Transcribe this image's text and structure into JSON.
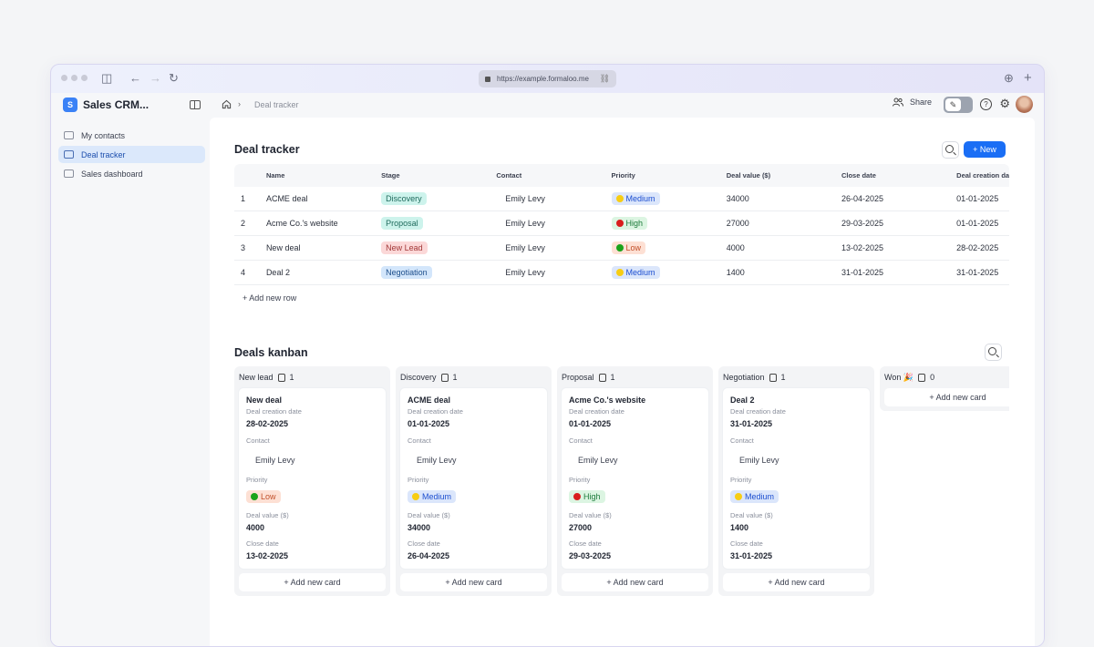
{
  "browser": {
    "url": "https://example.formaloo.me"
  },
  "app": {
    "logo_letter": "S",
    "name": "Sales CRM...",
    "breadcrumb": "Deal tracker",
    "share_label": "Share",
    "help_glyph": "?",
    "gear_glyph": "⚙",
    "edit_glyph": "✎"
  },
  "sidebar": {
    "items": [
      {
        "label": "My contacts",
        "icon": "contacts-icon",
        "active": false
      },
      {
        "label": "Deal tracker",
        "icon": "card-icon",
        "active": true
      },
      {
        "label": "Sales dashboard",
        "icon": "chart-icon",
        "active": false
      }
    ]
  },
  "table": {
    "title": "Deal tracker",
    "new_label": "+ New",
    "columns": [
      "",
      "Name",
      "Stage",
      "Contact",
      "Priority",
      "Deal value ($)",
      "Close date",
      "Deal creation date"
    ],
    "rows": [
      {
        "num": "1",
        "name": "ACME deal",
        "stage": "Discovery",
        "contact": "Emily Levy",
        "priority": "Medium",
        "value": "34000",
        "close": "26-04-2025",
        "created": "01-01-2025"
      },
      {
        "num": "2",
        "name": "Acme Co.'s website",
        "stage": "Proposal",
        "contact": "Emily Levy",
        "priority": "High",
        "value": "27000",
        "close": "29-03-2025",
        "created": "01-01-2025"
      },
      {
        "num": "3",
        "name": "New deal",
        "stage": "New Lead",
        "contact": "Emily Levy",
        "priority": "Low",
        "value": "4000",
        "close": "13-02-2025",
        "created": "28-02-2025"
      },
      {
        "num": "4",
        "name": "Deal 2",
        "stage": "Negotiation",
        "contact": "Emily Levy",
        "priority": "Medium",
        "value": "1400",
        "close": "31-01-2025",
        "created": "31-01-2025"
      }
    ],
    "add_row_label": "+ Add new row"
  },
  "styles": {
    "stages": {
      "Discovery": {
        "bg": "#cdf3ec",
        "fg": "#1f6b5d"
      },
      "Proposal": {
        "bg": "#cdf3ec",
        "fg": "#1f6b5d"
      },
      "New Lead": {
        "bg": "#fbd8d8",
        "fg": "#a33838"
      },
      "Negotiation": {
        "bg": "#d3e6fb",
        "fg": "#1e4f8c"
      }
    },
    "priorities": {
      "Medium": {
        "bg": "#dbe6fb",
        "fg": "#1d4fd0",
        "dot": "#f7cd14"
      },
      "High": {
        "bg": "#dcf5e2",
        "fg": "#1c7a3a",
        "dot": "#d91e1e"
      },
      "Low": {
        "bg": "#fde0d4",
        "fg": "#c2502a",
        "dot": "#1aa31a"
      }
    }
  },
  "kanban": {
    "title": "Deals kanban",
    "labels": {
      "created": "Deal creation date",
      "contact": "Contact",
      "priority": "Priority",
      "value": "Deal value ($)",
      "close": "Close date",
      "add_card": "+ Add new card"
    },
    "columns": [
      {
        "name": "New lead",
        "count": "1",
        "cards": [
          {
            "title": "New deal",
            "created": "28-02-2025",
            "contact": "Emily Levy",
            "priority": "Low",
            "value": "4000",
            "close": "13-02-2025"
          }
        ]
      },
      {
        "name": "Discovery",
        "count": "1",
        "cards": [
          {
            "title": "ACME deal",
            "created": "01-01-2025",
            "contact": "Emily Levy",
            "priority": "Medium",
            "value": "34000",
            "close": "26-04-2025"
          }
        ]
      },
      {
        "name": "Proposal",
        "count": "1",
        "cards": [
          {
            "title": "Acme Co.'s website",
            "created": "01-01-2025",
            "contact": "Emily Levy",
            "priority": "High",
            "value": "27000",
            "close": "29-03-2025"
          }
        ]
      },
      {
        "name": "Negotiation",
        "count": "1",
        "cards": [
          {
            "title": "Deal 2",
            "created": "31-01-2025",
            "contact": "Emily Levy",
            "priority": "Medium",
            "value": "1400",
            "close": "31-01-2025"
          }
        ]
      },
      {
        "name": "Won 🎉",
        "count": "0",
        "cards": []
      }
    ]
  }
}
